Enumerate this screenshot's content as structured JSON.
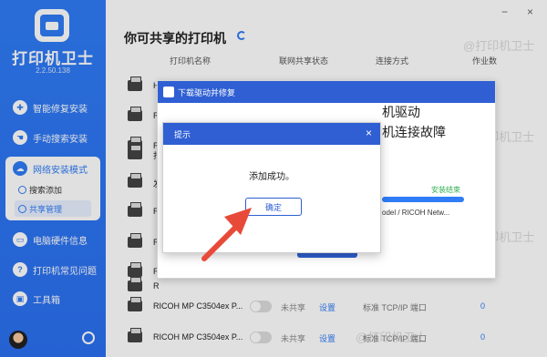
{
  "sidebar": {
    "app_title": "打印机卫士",
    "version": "2.2.50.138",
    "items": [
      {
        "label": "智能修复安装",
        "icon": "repair-icon"
      },
      {
        "label": "手动搜索安装",
        "icon": "hand-icon"
      },
      {
        "label": "网络安装模式",
        "icon": "cloud-icon"
      },
      {
        "label": "电脑硬件信息",
        "icon": "computer-icon"
      },
      {
        "label": "打印机常见问题",
        "icon": "question-icon"
      },
      {
        "label": "工具箱",
        "icon": "toolbox-icon"
      }
    ],
    "sub_items": [
      {
        "label": "搜索添加"
      },
      {
        "label": "共享管理"
      }
    ]
  },
  "main": {
    "title": "你可共享的打印机",
    "columns": [
      "打印机名称",
      "联网共享状态",
      "连接方式",
      "作业数"
    ],
    "rows": [
      {
        "name": "H",
        "share": "",
        "setting": "",
        "conn": "",
        "jobs": ""
      },
      {
        "name": "R",
        "share": "",
        "setting": "",
        "conn": "",
        "jobs": ""
      },
      {
        "name": "R",
        "share": "",
        "setting": "",
        "conn": "",
        "jobs": ""
      },
      {
        "name": "打",
        "share": "",
        "setting": "",
        "conn": "",
        "jobs": ""
      },
      {
        "name": "发",
        "share": "",
        "setting": "",
        "conn": "",
        "jobs": ""
      },
      {
        "name": "R",
        "share": "",
        "setting": "",
        "conn": "",
        "jobs": ""
      },
      {
        "name": "R",
        "share": "",
        "setting": "",
        "conn": "",
        "jobs": ""
      },
      {
        "name": "R",
        "share": "",
        "setting": "",
        "conn": "",
        "jobs": ""
      },
      {
        "name": "R",
        "share": "",
        "setting": "",
        "conn": "",
        "jobs": ""
      },
      {
        "name": "RICOH MP C3504ex P...",
        "share": "未共享",
        "setting": "设置",
        "conn": "标准 TCP/IP 端口",
        "jobs": "0"
      },
      {
        "name": "RICOH MP C3504ex P...",
        "share": "未共享",
        "setting": "设置",
        "conn": "标准 TCP/IP 端口",
        "jobs": "0"
      }
    ],
    "window_controls": {
      "minimize": "−",
      "close": "×"
    }
  },
  "dialog_driver": {
    "title": "下载驱动并修复",
    "line1": "机驱动",
    "line2": "机连接故障",
    "progress_label": "安装结束",
    "model_text": "odel / RICOH Netw...",
    "finish_button": "安装结束",
    "progress": 1.0
  },
  "dialog_tip": {
    "title": "提示",
    "message": "添加成功。",
    "ok_button": "确定",
    "close": "×"
  },
  "watermark": "@打印机卫士",
  "colors": {
    "brand": "#2f7cf6",
    "header": "#2f5fd3",
    "arrow": "#e84a3a"
  }
}
